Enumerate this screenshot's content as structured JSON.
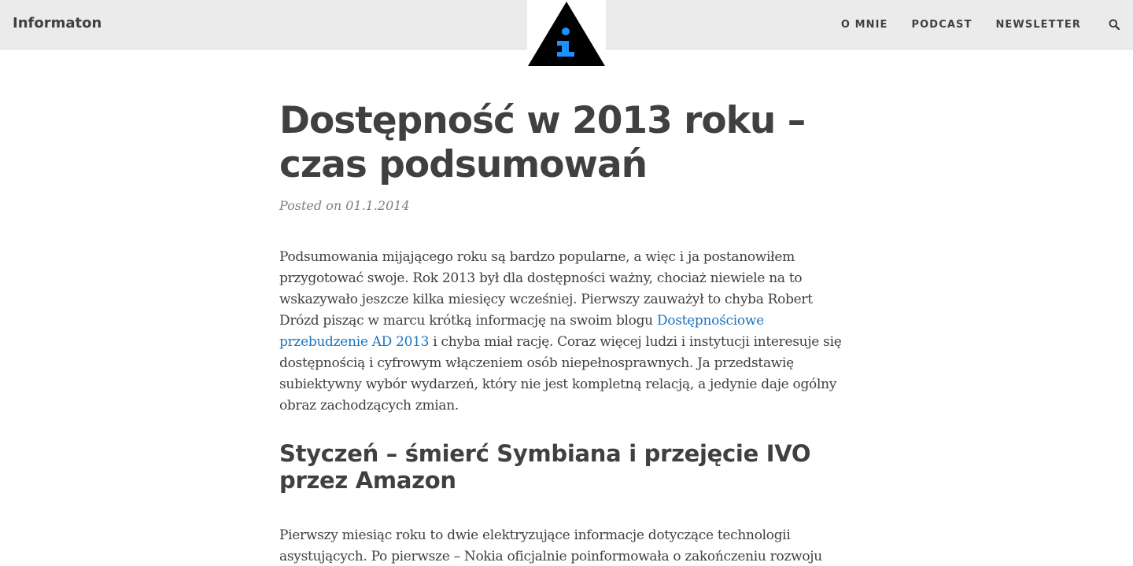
{
  "site": {
    "title": "Informaton"
  },
  "logo": {
    "glyph": "i",
    "accent_color": "#1e90ff"
  },
  "nav": {
    "items": [
      {
        "label": "O MNIE"
      },
      {
        "label": "PODCAST"
      },
      {
        "label": "NEWSLETTER"
      }
    ],
    "search_icon": "search-icon"
  },
  "post": {
    "title_line1": "Dostępność w 2013 roku –",
    "title_line2": "czas podsumowań",
    "meta": "Posted on 01.1.2014",
    "intro_before_link": "Podsumowania mijającego roku są bardzo popularne, a więc i ja postanowiłem przygotować swoje. Rok 2013 był dla dostępności ważny, chociaż niewiele na to wskazywało jeszcze kilka miesięcy wcześniej. Pierwszy zauważył to chyba Robert Drózd pisząc w marcu krótką informację na swoim blogu ",
    "intro_link": "Dostępnościowe przebudzenie AD 2013",
    "intro_after_link": " i chyba miał rację. Coraz więcej ludzi i instytucji interesuje się dostępnością i cyfrowym włączeniem osób niepełnosprawnych. Ja przedstawię subiektywny wybór wydarzeń, który nie jest kompletną relacją, a jedynie daje ogólny obraz zachodzących zmian.",
    "section_heading": "Styczeń – śmierć Symbiana i przejęcie IVO przez Amazon",
    "section_para": "Pierwszy miesiąc roku to dwie elektryzujące informacje dotyczące technologii asystujących. Po pierwsze – Nokia oficjalnie poinformowała o zakończeniu rozwoju systemu operacyjnego dla telefonów komórkowych Symbian. To był koniec pewnej"
  },
  "colors": {
    "link": "#1e73be",
    "text": "#404040",
    "topbar": "#ebebeb"
  }
}
